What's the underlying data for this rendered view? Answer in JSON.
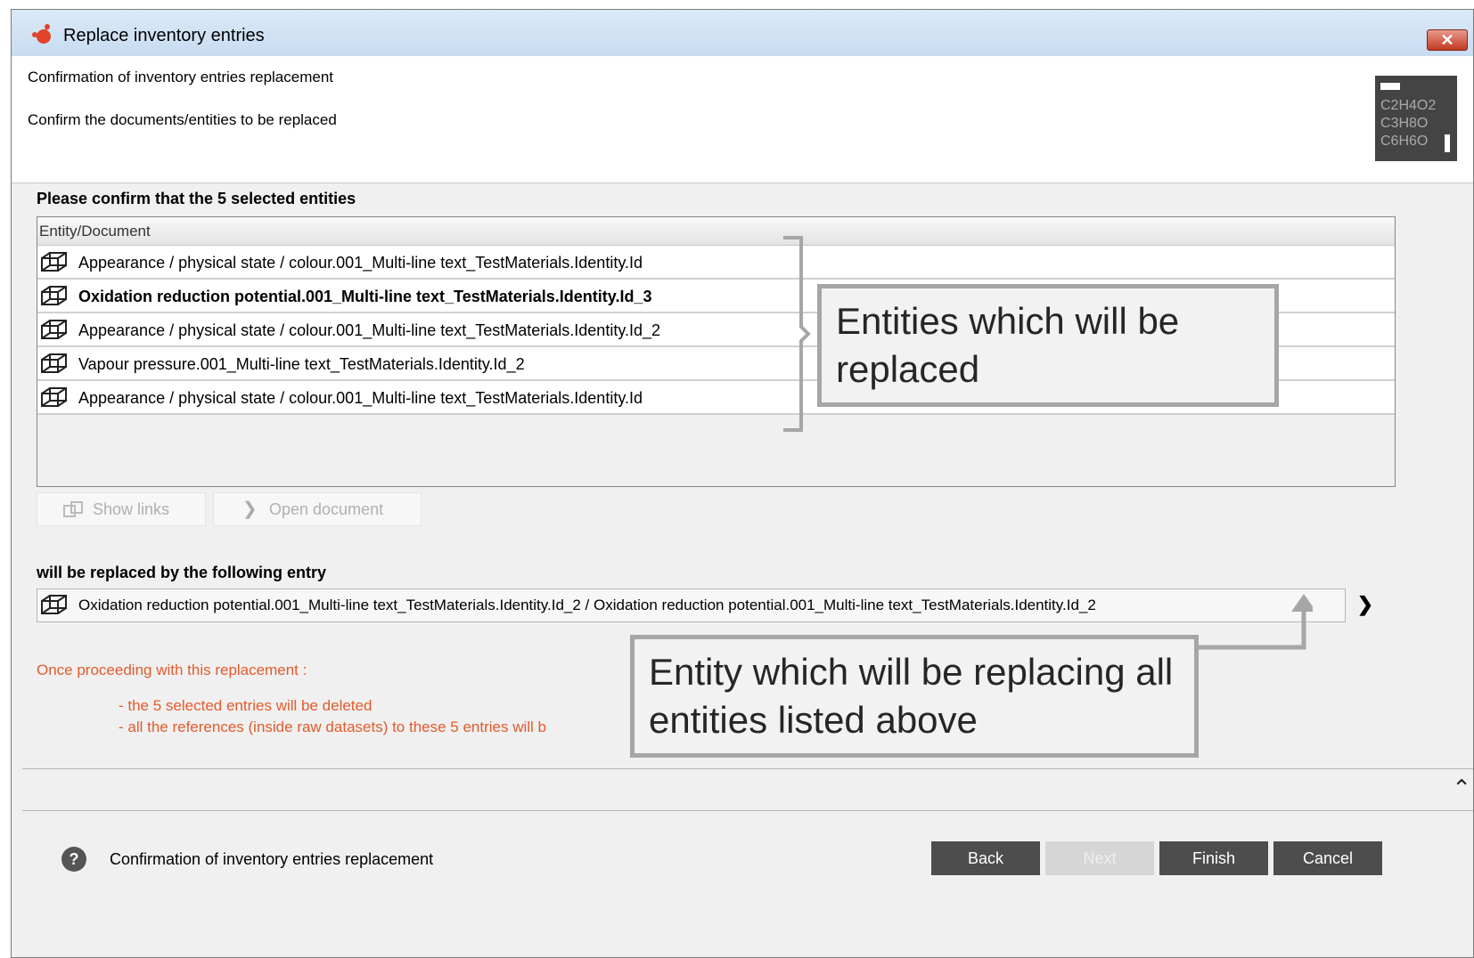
{
  "window": {
    "title": "Replace inventory entries",
    "close_label": "✕"
  },
  "header": {
    "heading": "Confirmation of inventory entries replacement",
    "subheading": "Confirm the documents/entities to be replaced",
    "logo_lines": [
      "C2H4O2",
      "C3H8O",
      "C6H6O"
    ]
  },
  "selection": {
    "label": "Please confirm that the 5 selected entities",
    "column_header": "Entity/Document",
    "rows": [
      {
        "text": "Appearance / physical state / colour.001_Multi-line text_TestMaterials.Identity.Id"
      },
      {
        "text": "Oxidation reduction potential.001_Multi-line text_TestMaterials.Identity.Id_3"
      },
      {
        "text": "Appearance / physical state / colour.001_Multi-line text_TestMaterials.Identity.Id_2"
      },
      {
        "text": "Vapour pressure.001_Multi-line text_TestMaterials.Identity.Id_2"
      },
      {
        "text": "Appearance / physical state / colour.001_Multi-line text_TestMaterials.Identity.Id"
      }
    ]
  },
  "actions": {
    "show_links": "Show links",
    "open_document": "Open document"
  },
  "replacement": {
    "label": "will be replaced by the following entry",
    "entry": "Oxidation reduction potential.001_Multi-line text_TestMaterials.Identity.Id_2 / Oxidation reduction potential.001_Multi-line text_TestMaterials.Identity.Id_2"
  },
  "warning": {
    "intro": "Once proceeding with this replacement :",
    "line1": "- the 5 selected entries will be deleted",
    "line2": "- all the references (inside raw datasets) to these 5 entries will b"
  },
  "callouts": {
    "entities": "Entities which will be replaced",
    "entity": "Entity which will be replacing all entities listed above"
  },
  "footer": {
    "status": "Confirmation of inventory entries replacement",
    "back": "Back",
    "next": "Next",
    "finish": "Finish",
    "cancel": "Cancel"
  },
  "colors": {
    "warning": "#e25b2c",
    "callout_border": "#a6a6a6",
    "button_dark": "#4d4d4d"
  }
}
